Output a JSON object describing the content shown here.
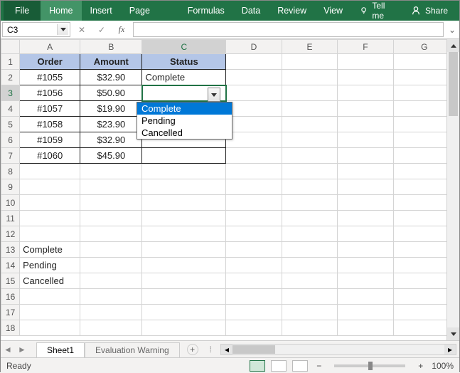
{
  "ribbon": {
    "tabs": [
      "File",
      "Home",
      "Insert",
      "Page Layout",
      "Formulas",
      "Data",
      "Review",
      "View"
    ],
    "tell": "Tell me",
    "share": "Share"
  },
  "namebox": {
    "value": "C3"
  },
  "formula_bar": {
    "value": ""
  },
  "columns": [
    "A",
    "B",
    "C",
    "D",
    "E",
    "F",
    "G"
  ],
  "row_count": 18,
  "active_cell": {
    "row": 3,
    "col": "C"
  },
  "table": {
    "headers": [
      "Order",
      "Amount",
      "Status"
    ],
    "rows": [
      {
        "order": "#1055",
        "amount": "$32.90",
        "status": "Complete"
      },
      {
        "order": "#1056",
        "amount": "$50.90",
        "status": ""
      },
      {
        "order": "#1057",
        "amount": "$19.90",
        "status": ""
      },
      {
        "order": "#1058",
        "amount": "$23.90",
        "status": ""
      },
      {
        "order": "#1059",
        "amount": "$32.90",
        "status": ""
      },
      {
        "order": "#1060",
        "amount": "$45.90",
        "status": ""
      }
    ]
  },
  "loose_cells": {
    "A13": "Complete",
    "A14": "Pending",
    "A15": "Cancelled"
  },
  "dropdown": {
    "options": [
      "Complete",
      "Pending",
      "Cancelled"
    ],
    "selected_index": 0
  },
  "sheet_tabs": {
    "active": "Sheet1",
    "tabs": [
      "Sheet1",
      "Evaluation Warning"
    ]
  },
  "status_bar": {
    "mode": "Ready",
    "zoom": "100%"
  },
  "chart_data": {
    "type": "table",
    "headers": [
      "Order",
      "Amount",
      "Status"
    ],
    "rows": [
      [
        "#1055",
        "$32.90",
        "Complete"
      ],
      [
        "#1056",
        "$50.90",
        ""
      ],
      [
        "#1057",
        "$19.90",
        ""
      ],
      [
        "#1058",
        "$23.90",
        ""
      ],
      [
        "#1059",
        "$32.90",
        ""
      ],
      [
        "#1060",
        "$45.90",
        ""
      ]
    ],
    "validation_list": [
      "Complete",
      "Pending",
      "Cancelled"
    ]
  }
}
